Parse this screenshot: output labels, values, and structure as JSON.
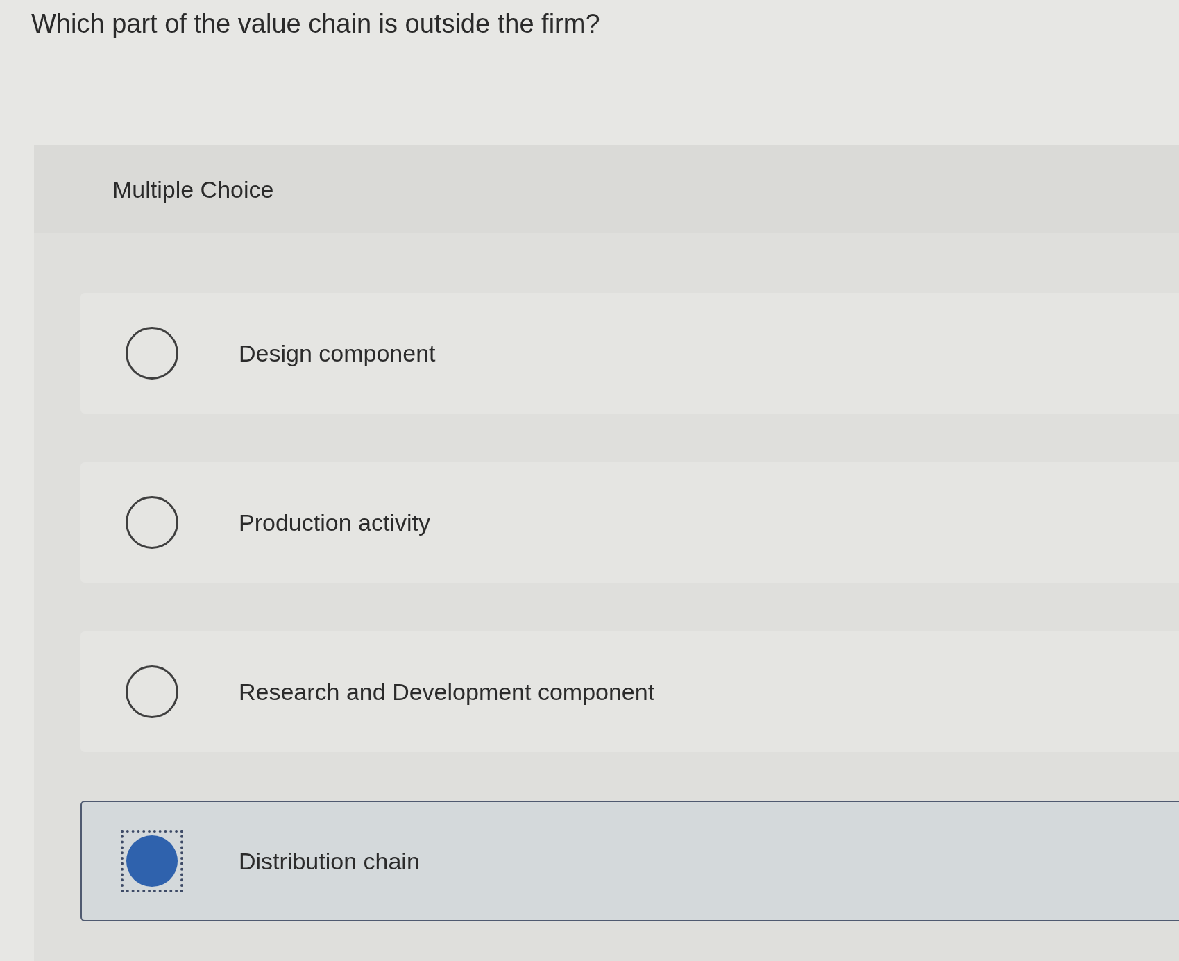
{
  "question": "Which part of the value chain is outside the firm?",
  "panel": {
    "title": "Multiple Choice",
    "options": [
      {
        "label": "Design component",
        "selected": false
      },
      {
        "label": "Production activity",
        "selected": false
      },
      {
        "label": "Research and Development component",
        "selected": false
      },
      {
        "label": "Distribution chain",
        "selected": true
      }
    ]
  }
}
